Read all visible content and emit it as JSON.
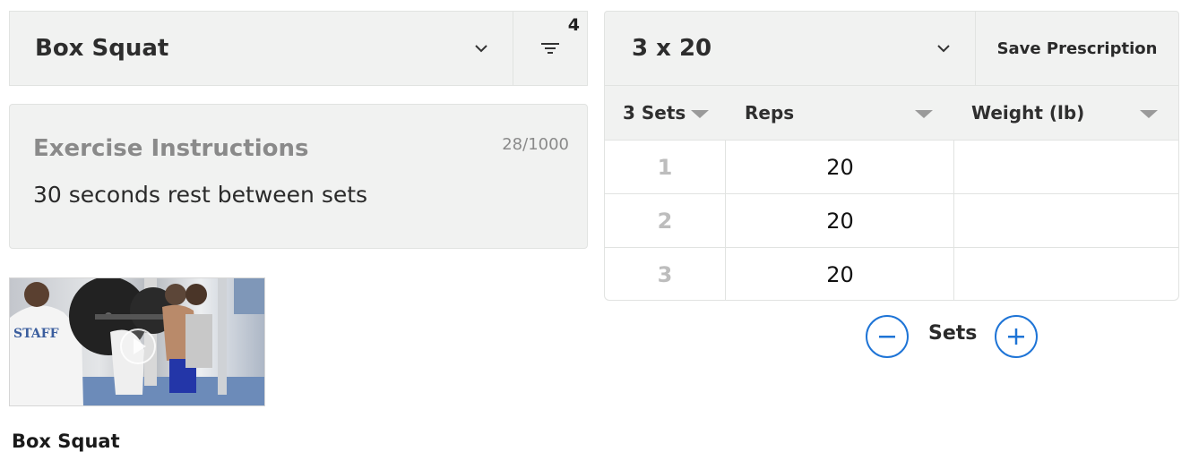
{
  "exercise": {
    "selected": "Box Squat",
    "filter_count": "4"
  },
  "instructions": {
    "title": "Exercise Instructions",
    "char_count": "28/1000",
    "text": "30 seconds rest between sets"
  },
  "video": {
    "caption": "Box Squat",
    "shirt_text": "STAFF"
  },
  "prescription": {
    "selected": "3 x 20",
    "save_label": "Save Prescription",
    "columns": [
      "3 Sets",
      "Reps",
      "Weight (lb)"
    ],
    "rows": [
      {
        "set": "1",
        "reps": "20",
        "weight": ""
      },
      {
        "set": "2",
        "reps": "20",
        "weight": ""
      },
      {
        "set": "3",
        "reps": "20",
        "weight": ""
      }
    ],
    "sets_label": "Sets"
  },
  "colors": {
    "accent": "#1e74d6",
    "panel": "#f1f2f1"
  }
}
